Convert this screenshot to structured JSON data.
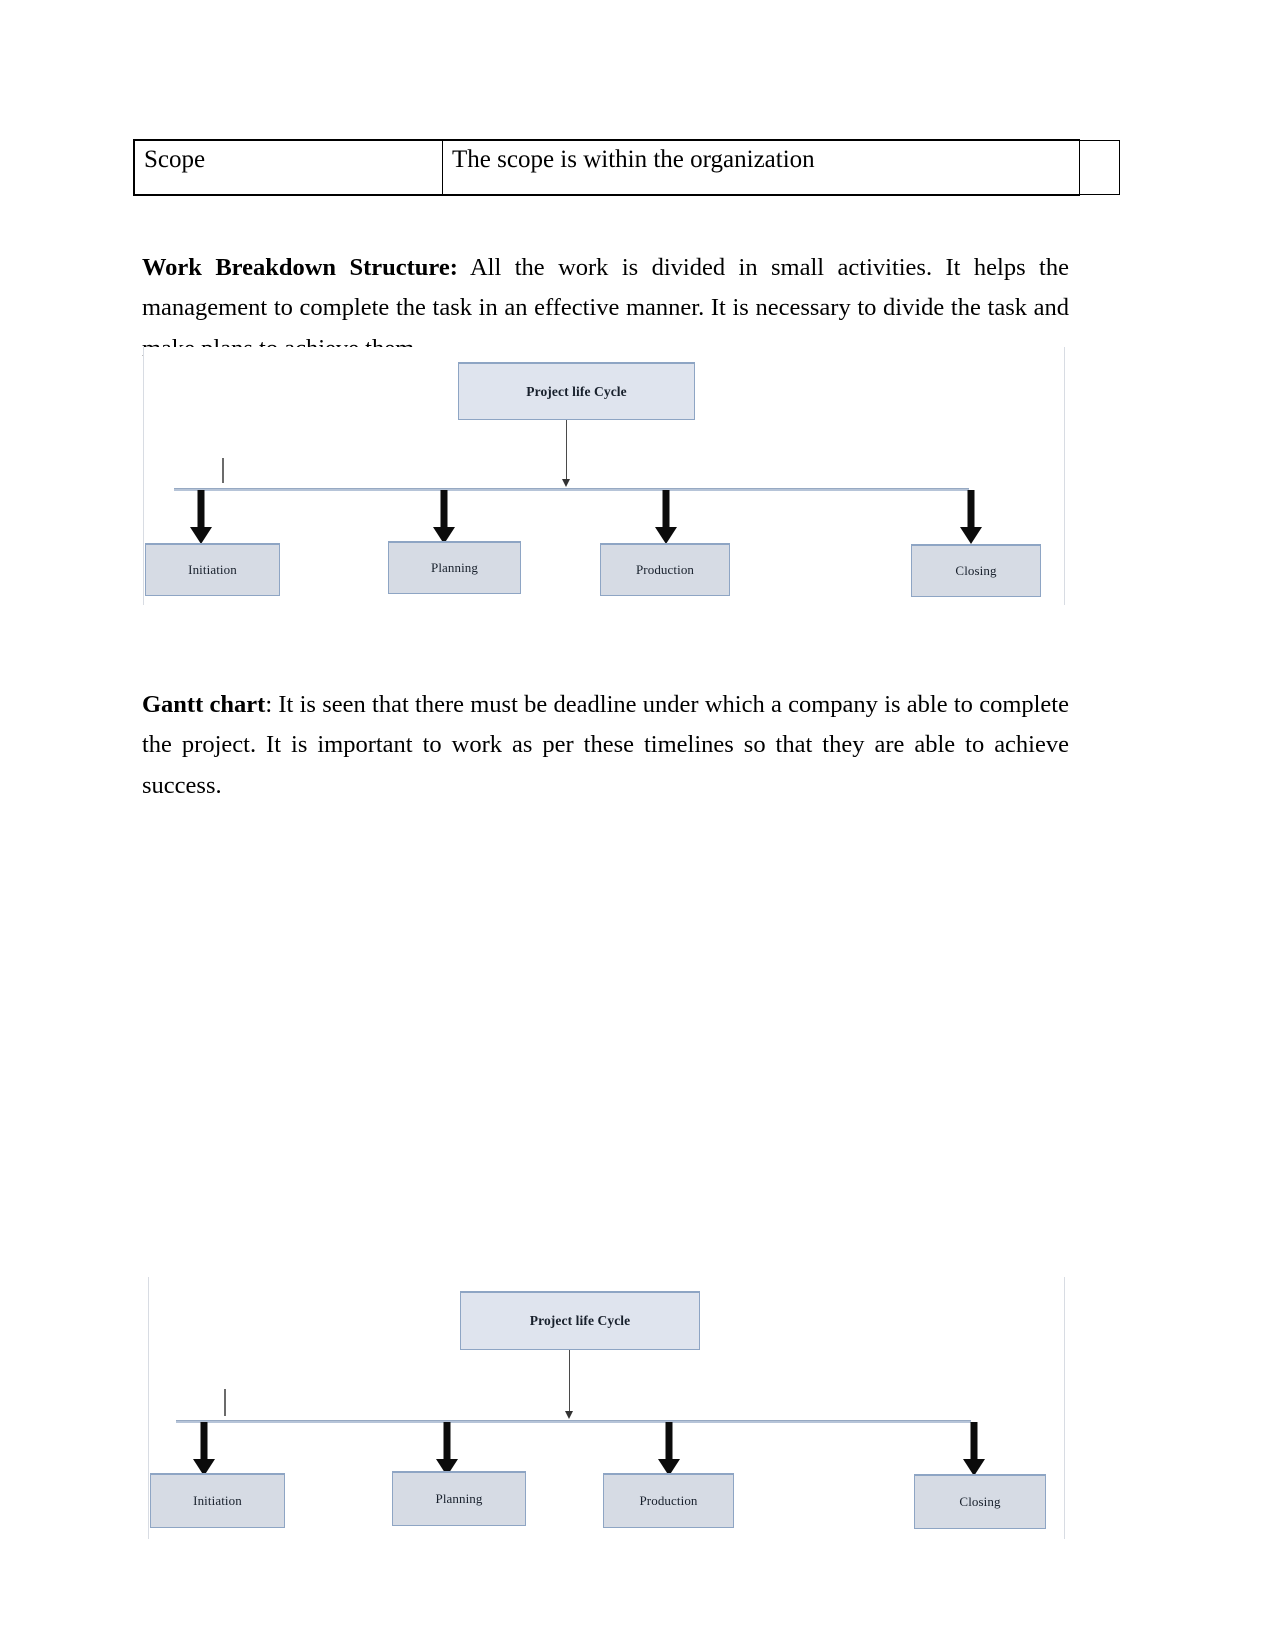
{
  "document": {
    "table": {
      "rows": [
        {
          "label": "Scope",
          "value": "The scope is within the organization"
        }
      ]
    },
    "paragraphs": [
      {
        "id": "wbs",
        "lead": "Work Breakdown Structure:",
        "body": " All the work is divided in small activities. It helps the management to complete the task in an effective manner. It is necessary to divide the task and make plans to achieve them."
      },
      {
        "id": "gantt",
        "lead": "Gantt chart",
        "body": ": It is seen that there must be deadline under which a company is able to complete the project. It is important to work as per these timelines so that they are able to achieve success."
      }
    ],
    "diagrams": [
      {
        "name": "project-life-cycle-wbs-1",
        "root": "Project life Cycle",
        "children": [
          "Initiation",
          "Planning",
          "Production",
          "Closing"
        ]
      },
      {
        "name": "project-life-cycle-wbs-2",
        "root": "Project life Cycle",
        "children": [
          "Initiation",
          "Planning",
          "Production",
          "Closing"
        ]
      }
    ],
    "colors": {
      "root_fill": "#dfe4ee",
      "leaf_fill": "#d6dbe4",
      "node_border": "#8ea5c4",
      "bus_line": "#b6c4d8",
      "arrow": "#0b0b0b"
    }
  }
}
